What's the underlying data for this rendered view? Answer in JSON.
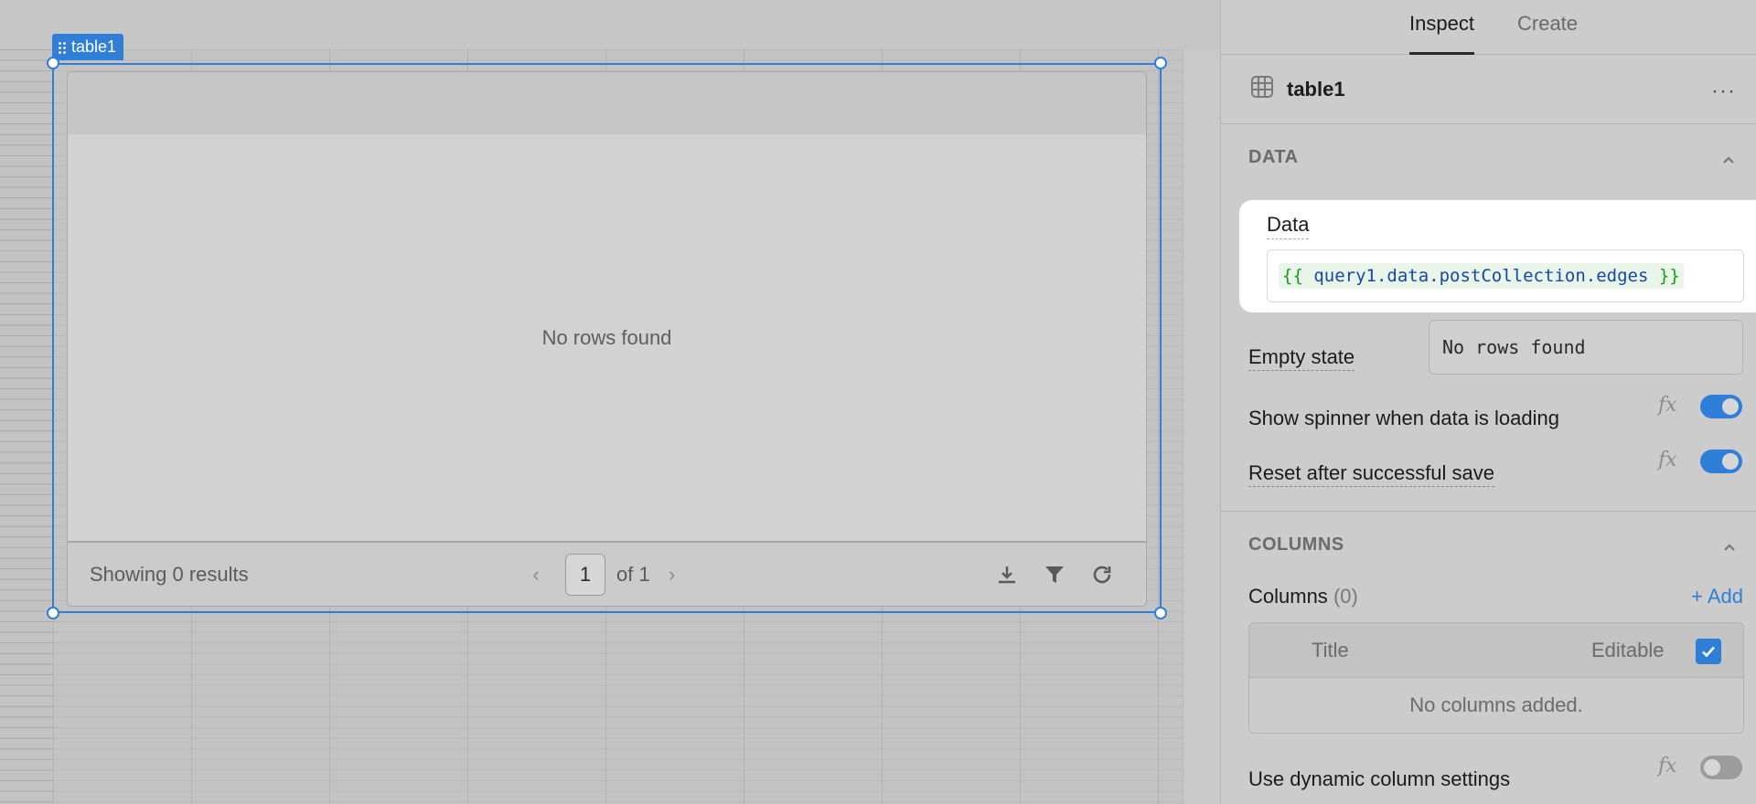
{
  "canvas": {
    "component_tag": "table1",
    "table": {
      "empty_message": "No rows found",
      "results_text": "Showing 0 results",
      "pagination": {
        "prev": "‹",
        "current_page": "1",
        "of_text": "of 1",
        "next": "›"
      },
      "footer_icons": [
        "download-icon",
        "filter-icon",
        "refresh-icon"
      ]
    }
  },
  "panel": {
    "tabs": [
      {
        "label": "Inspect",
        "active": true
      },
      {
        "label": "Create",
        "active": false
      }
    ],
    "component": {
      "name": "table1",
      "icon": "table-grid-icon",
      "more": "···"
    },
    "data_section": {
      "title": "DATA",
      "data_field": {
        "label": "Data",
        "open_braces": "{{",
        "expression": "query1.data.postCollection.edges",
        "close_braces": "}}"
      },
      "empty_state": {
        "label": "Empty state",
        "value": "No rows found"
      },
      "show_spinner": {
        "label": "Show spinner when data is loading",
        "fx": "fx",
        "enabled": true
      },
      "reset_after_save": {
        "label": "Reset after successful save",
        "fx": "fx",
        "enabled": true
      }
    },
    "columns_section": {
      "title": "COLUMNS",
      "columns_label": "Columns",
      "columns_count": "(0)",
      "add_label": "+ Add",
      "header_title": "Title",
      "header_editable": "Editable",
      "editable_checked": true,
      "empty_text": "No columns added.",
      "dynamic_settings": {
        "label": "Use dynamic column settings",
        "fx": "fx",
        "enabled": false
      }
    }
  },
  "colors": {
    "accent": "#2f7fd8",
    "code_green": "#1c9a1c",
    "code_blue": "#1447a8"
  }
}
